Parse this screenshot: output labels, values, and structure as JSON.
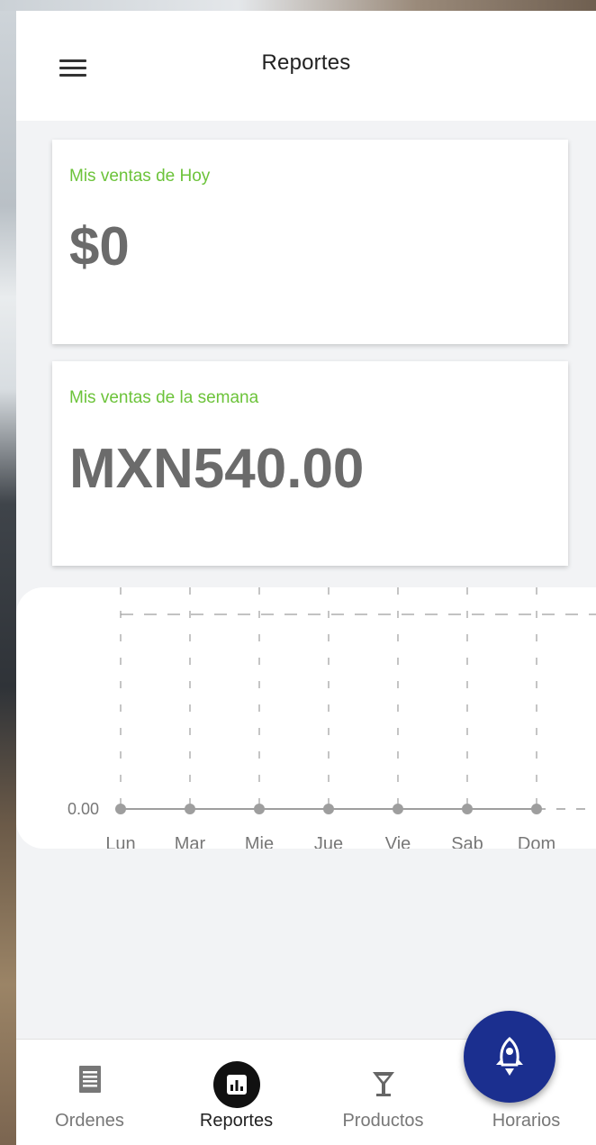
{
  "header": {
    "title": "Reportes"
  },
  "cards": {
    "today": {
      "label": "Mis ventas de Hoy",
      "value": "$0"
    },
    "week": {
      "label": "Mis ventas de la semana",
      "value": "MXN540.00"
    }
  },
  "chart_data": {
    "type": "line",
    "categories": [
      "Lun",
      "Mar",
      "Mie",
      "Jue",
      "Vie",
      "Sab",
      "Dom"
    ],
    "series": [
      {
        "values": [
          0,
          0,
          0,
          0,
          0,
          0,
          0
        ]
      }
    ],
    "y_tick_labels": [
      "0.00"
    ],
    "grid": true,
    "colors": {
      "line": "#9e9e9e",
      "point": "#9e9e9e",
      "grid": "#9e9e9e",
      "text": "#777777"
    }
  },
  "tabs": [
    {
      "label": "Ordenes",
      "icon": "receipt-icon"
    },
    {
      "label": "Reportes",
      "icon": "bar-chart-icon",
      "active": true
    },
    {
      "label": "Productos",
      "icon": "cocktail-glass-icon"
    },
    {
      "label": "Horarios",
      "icon": "clock-icon"
    }
  ],
  "fab": {
    "icon": "rocket-icon"
  },
  "colors": {
    "accent_green": "#6cc33a",
    "fab_blue": "#1b2f8f",
    "background": "#f2f3f5"
  }
}
